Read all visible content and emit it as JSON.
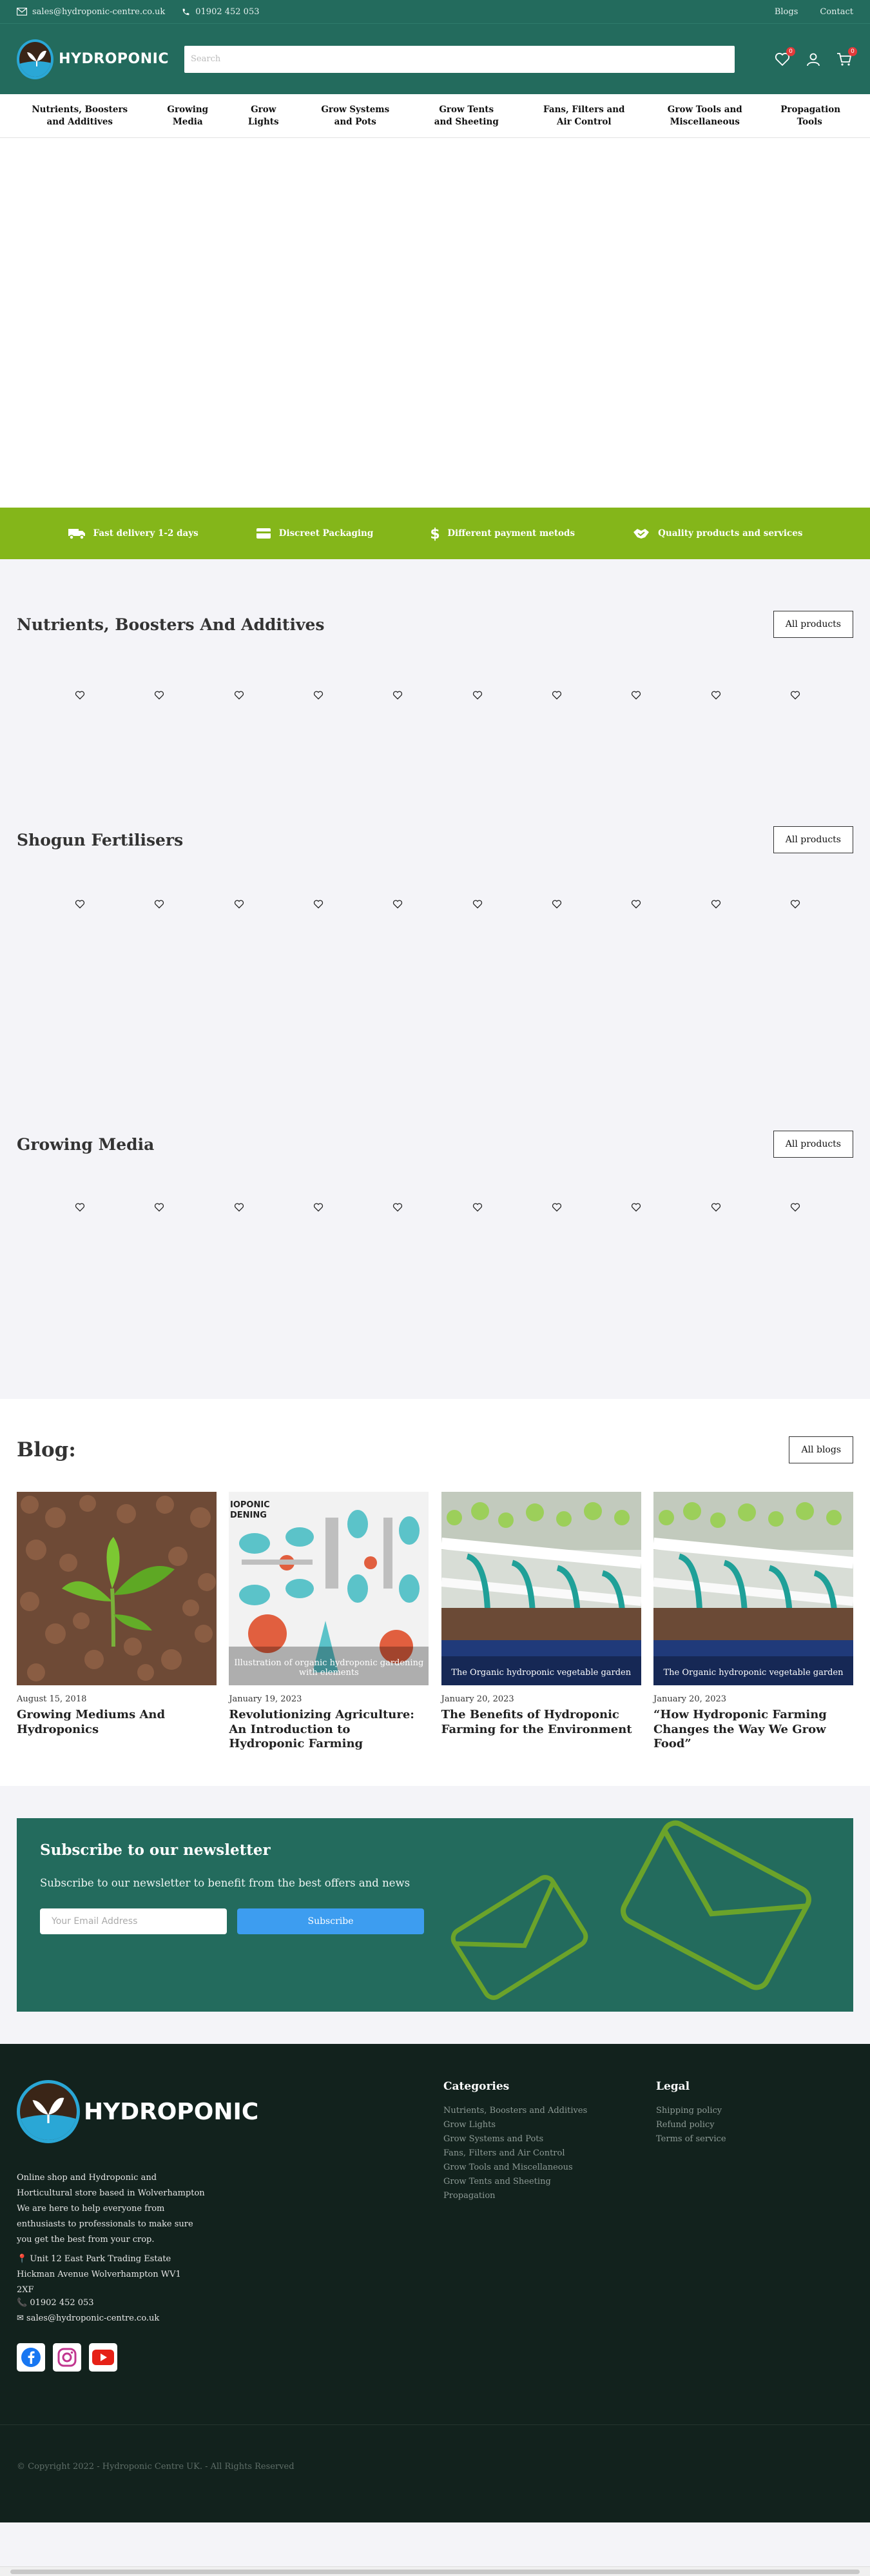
{
  "topbar": {
    "email": "sales@hydroponic-centre.co.uk",
    "phone": "01902 452 053",
    "links": [
      "Blogs",
      "Contact"
    ]
  },
  "header": {
    "brand": "HYDROPONIC",
    "search_placeholder": "Search",
    "wishlist_count": "0",
    "cart_count": "0"
  },
  "nav": [
    "Nutrients, Boosters and Additives",
    "Growing Media",
    "Grow Lights",
    "Grow Systems and Pots",
    "Grow Tents and Sheeting",
    "Fans, Filters and Air Control",
    "Grow Tools and Miscellaneous",
    "Propagation Tools"
  ],
  "features": [
    "Fast delivery 1-2 days",
    "Discreet Packaging",
    "Different payment metods",
    "Quality products and services"
  ],
  "sections": [
    {
      "title": "Nutrients, Boosters And Additives",
      "button": "All products"
    },
    {
      "title": "Shogun Fertilisers",
      "button": "All products"
    },
    {
      "title": "Growing Media",
      "button": "All products"
    }
  ],
  "blog": {
    "title": "Blog:",
    "button": "All blogs",
    "posts": [
      {
        "date": "August 15, 2018",
        "title": "Growing Mediums And Hydroponics",
        "caption": ""
      },
      {
        "date": "January 19, 2023",
        "title": "Revolutionizing Agriculture: An Introduction to Hydroponic Farming",
        "caption": "Illustration of organic hydroponic gardening with elements"
      },
      {
        "date": "January 20, 2023",
        "title": "The Benefits of Hydroponic Farming for the Environment",
        "caption": "The Organic hydroponic vegetable garden"
      },
      {
        "date": "January 20, 2023",
        "title": "“How Hydroponic Farming Changes the Way We Grow Food”",
        "caption": "The Organic hydroponic vegetable garden"
      }
    ]
  },
  "newsletter": {
    "title": "Subscribe to our newsletter",
    "text": "Subscribe to our newsletter to benefit from the best offers and news",
    "placeholder": "Your Email Address",
    "button": "Subscribe"
  },
  "footer": {
    "brand": "HYDROPONIC",
    "description": "Online shop and Hydroponic and Horticultural store based in Wolverhampton We are here to help everyone from enthusiasts to professionals to make sure you get the best from your crop.",
    "address": "Unit 12 East Park Trading Estate Hickman Avenue Wolverhampton WV1 2XF",
    "phone": "01902 452 053",
    "email": "sales@hydroponic-centre.co.uk",
    "categories_title": "Categories",
    "categories": [
      "Nutrients, Boosters and Additives",
      "Grow Lights",
      "Grow Systems and Pots",
      "Fans, Filters and Air Control",
      "Grow Tools and Miscellaneous",
      "Grow Tents and Sheeting",
      "Propagation"
    ],
    "legal_title": "Legal",
    "legal": [
      "Shipping policy",
      "Refund policy",
      "Terms of service"
    ],
    "copyright": "© Copyright 2022 - Hydroponic Centre UK. - All Rights Reserved"
  },
  "colors": {
    "primary": "#236b5d",
    "accent_green": "#84b61a",
    "footer_bg": "#12221d",
    "subscribe_blue": "#3d9df0",
    "badge_red": "#e23a3a"
  }
}
